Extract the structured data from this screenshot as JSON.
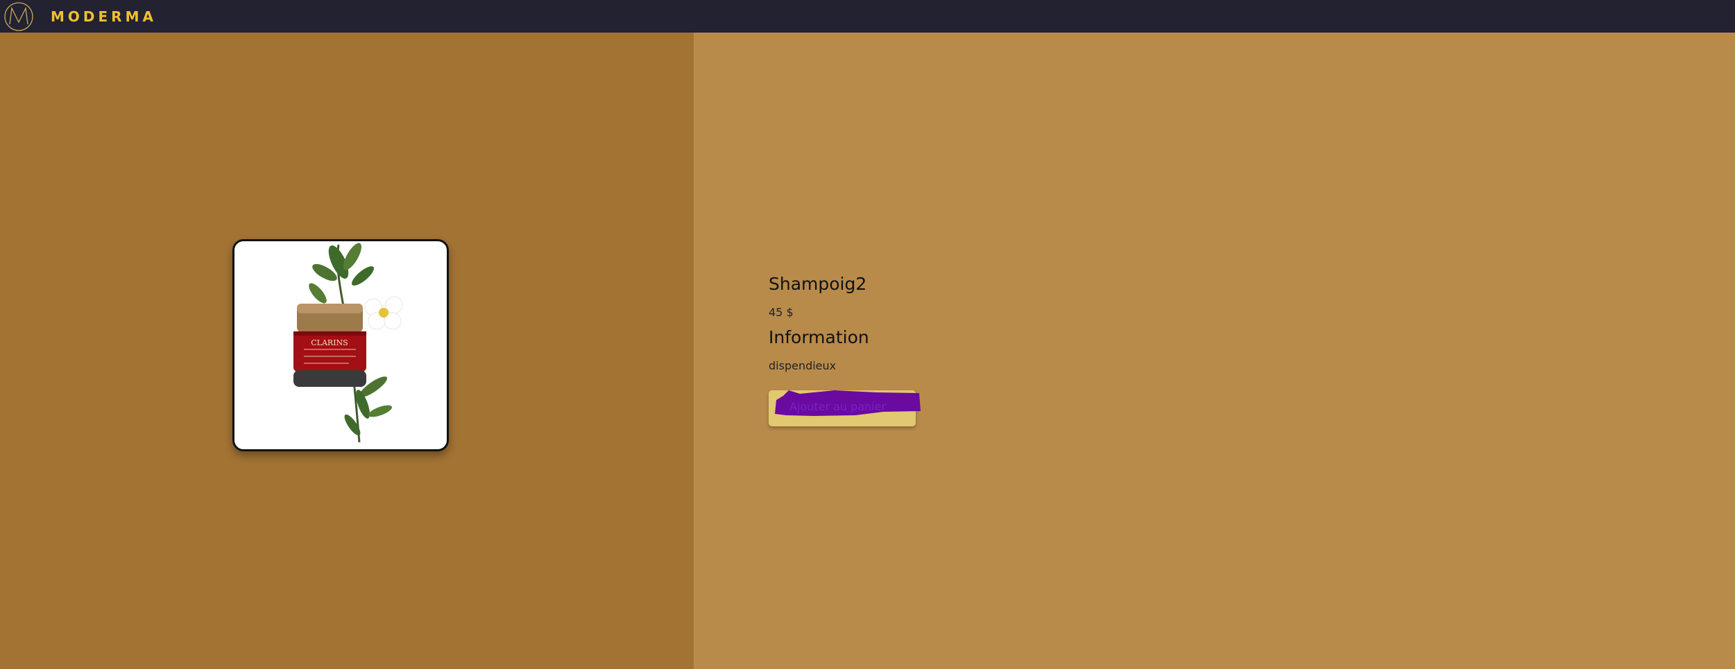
{
  "navbar": {
    "logo_icon": "moderma-logo-icon",
    "brand": "MODERMA"
  },
  "product": {
    "image_icon": "clarins-cream-jar-image",
    "image_brand_text": "CLARINS",
    "title": "Shampoig2",
    "price": "45 $",
    "info_heading": "Information",
    "info_text": "dispendieux",
    "cart_button_label": "Ajouter au panier"
  },
  "colors": {
    "navbar_bg": "#222230",
    "brand_accent": "#f0c030",
    "left_panel_bg": "#a37334",
    "right_panel_bg": "#b88b4b",
    "button_bg": "#e2c870",
    "button_scribble": "#6a0aa0",
    "button_text": "#7a20c8"
  }
}
